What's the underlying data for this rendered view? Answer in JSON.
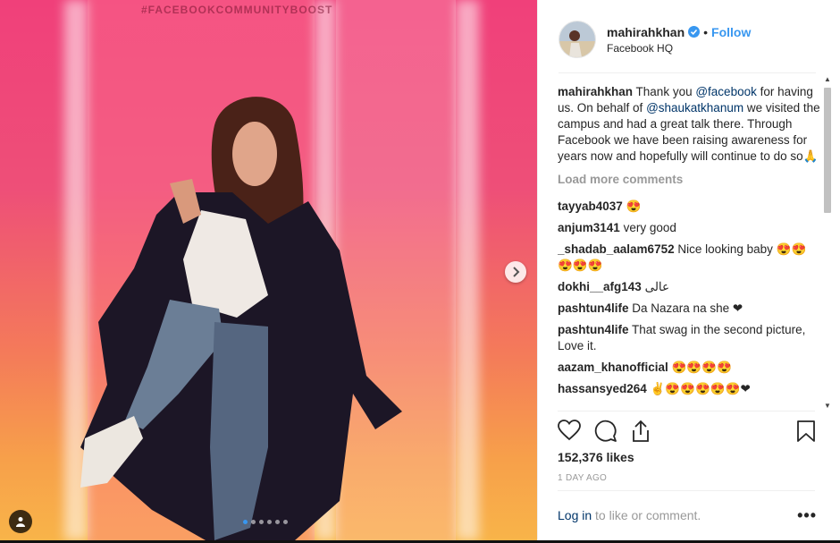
{
  "post": {
    "hashtag": "#FACEBOOKCOMMUNITYBOOST",
    "carousel_count": 6,
    "carousel_active": 1
  },
  "header": {
    "username": "mahirahkhan",
    "bullet": "•",
    "follow_label": "Follow",
    "location": "Facebook HQ"
  },
  "caption": {
    "username": "mahirahkhan",
    "part1": "Thank you ",
    "mention1": "@facebook",
    "part2": " for having us. On behalf of ",
    "mention2": "@shaukatkhanum",
    "part3": " we visited the campus and had a great talk there. Through Facebook we have been raising awareness for years now and hopefully will continue to do so🙏"
  },
  "load_more": "Load more comments",
  "comments": [
    {
      "user": "tayyab4037",
      "text": "😍"
    },
    {
      "user": "anjum3141",
      "text": "very good"
    },
    {
      "user": "_shadab_aalam6752",
      "text": "Nice looking baby 😍😍😍😍😍"
    },
    {
      "user": "dokhi__afg143",
      "text": "عالی"
    },
    {
      "user": "pashtun4life",
      "text": "Da Nazara na she ❤"
    },
    {
      "user": "pashtun4life",
      "text": "That swag in the second picture, Love it."
    },
    {
      "user": "aazam_khanofficial",
      "text": "😍😍😍😍"
    },
    {
      "user": "hassansyed264",
      "text": "✌😍😍😍😍😍❤"
    }
  ],
  "likes": "152,376 likes",
  "time_ago": "1 DAY AGO",
  "footer": {
    "login": "Log in",
    "rest": " to like or comment.",
    "more": "•••"
  },
  "colors": {
    "link_blue": "#3897f0",
    "mention": "#003569",
    "muted": "#999999"
  }
}
